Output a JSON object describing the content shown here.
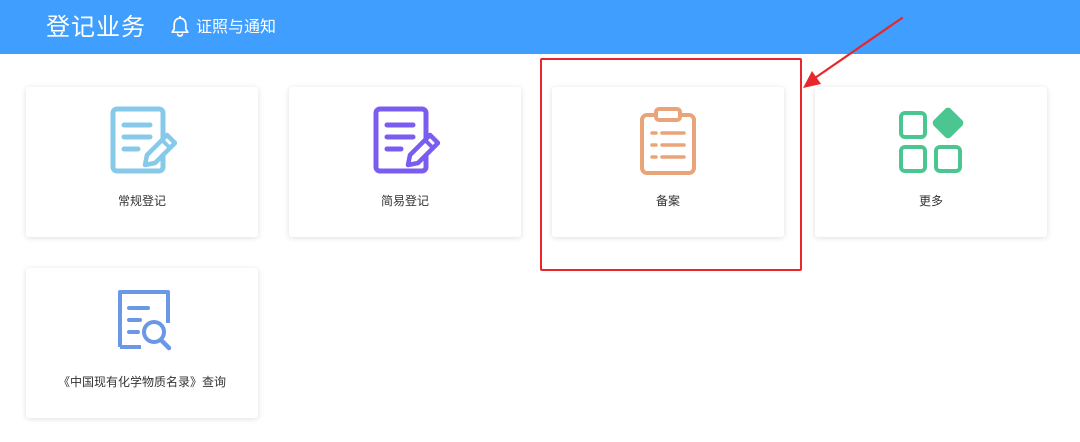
{
  "header": {
    "title": "登记业务",
    "notice_link": "证照与通知"
  },
  "cards": [
    {
      "label": "常规登记",
      "icon": "edit-document-icon",
      "color": "#87c9e9"
    },
    {
      "label": "简易登记",
      "icon": "edit-document-icon",
      "color": "#7b5cf0"
    },
    {
      "label": "备案",
      "icon": "clipboard-icon",
      "color": "#e9a47a"
    },
    {
      "label": "更多",
      "icon": "apps-grid-icon",
      "color": "#4cc690"
    },
    {
      "label": "《中国现有化学物质名录》查询",
      "icon": "document-search-icon",
      "color": "#6a98e6"
    }
  ],
  "colors": {
    "header_bg": "#409eff",
    "annotation": "#e8262c"
  }
}
